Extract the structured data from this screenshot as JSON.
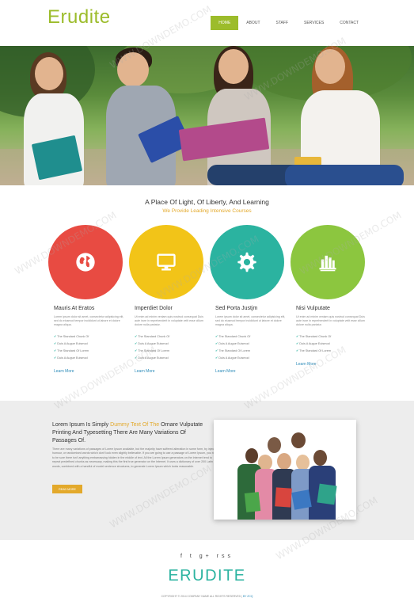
{
  "header": {
    "logo": "Erudite",
    "nav": [
      "HOME",
      "ABOUT",
      "STAFF",
      "SERVICES",
      "CONTACT"
    ],
    "active_nav": "HOME"
  },
  "intro": {
    "title": "A Place Of Light, Of Liberty, And Learning",
    "subtitle": "We Provide Leading Intensive Courses"
  },
  "features": [
    {
      "icon": "globe-icon",
      "color": "#e84b42",
      "title": "Mauris At Eratos",
      "text": "Lorem ipsum dolor sit amet, consectetur adipisicing elit, sed do eiusmod tempor incididunt ut labore et dolore magna aliqua.",
      "items": [
        "The Standard Chunk Of",
        "Duis A Augue Euismod",
        "The Standard Of Lorem",
        "Duis A Augue Euismod"
      ],
      "link": "Learn More"
    },
    {
      "icon": "monitor-icon",
      "color": "#f2c418",
      "title": "Imperdiet Dolor",
      "text": "Ut enim ad minim veniam quis nostrud consequat Duis aute irure in reprehenderit in voluptate velit esse cillum dolore nulla pariatur.",
      "items": [
        "The Standard Chunk Of",
        "Duis A Augue Euismod",
        "The Standard Of Lorem",
        "Duis A Augue Euismod"
      ],
      "link": "Learn More"
    },
    {
      "icon": "gear-icon",
      "color": "#2bb3a0",
      "title": "Sed Porta Justjm",
      "text": "Lorem ipsum dolor sit amet, consectetur adipisicing elit, sed do eiusmod tempor incididunt ut labore et dolore magna aliqua.",
      "items": [
        "The Standard Chunk Of",
        "Duis A Augue Euismod",
        "The Standard Of Lorem",
        "Duis A Augue Euismod"
      ],
      "link": "Learn More"
    },
    {
      "icon": "building-icon",
      "color": "#8cc63f",
      "title": "Nisi Vulputate",
      "text": "Ut enim ad minim veniam quis nostrud consequat Duis aute irure in reprehenderit in voluptate velit esse cillum dolore nulla pariatur.",
      "items": [
        "The Standard Chunk Of",
        "Duis A Augue Euismod",
        "The Standard Of Lorem"
      ],
      "link": "Learn More"
    }
  ],
  "about": {
    "heading_before": "Lorem Ipsum Is Simply ",
    "heading_highlight": "Dummy Text Of The",
    "heading_after": " Ornare Vulputate Printing And Typesetting There Are Many Variations Of Passages Of.",
    "text": "There are many variations of passages of Lorem Ipsum available, but the majority have suffered alteration in some form, by injected humour, or randomised words which don't look even slightly believable. If you are going to use a passage of Lorem Ipsum, you need to be sure there isn't anything embarrassing hidden in the middle of text. All the Lorem Ipsum generators on the Internet tend to repeat predefined chunks as necessary, making this the first true generator on the Internet. It uses a dictionary of over 200 Latin words, combined with a handful of model sentence structures, to generate Lorem Ipsum which looks reasonable.",
    "button": "READ MORE"
  },
  "footer": {
    "social": "f  t  g+  rss",
    "logo": "ERUDITE",
    "copyright_text": "COPYRIGHT © 2014 COMPANY NAME ALL RIGHTS RESERVED | ",
    "copyright_link": "BY ZCQ"
  },
  "watermark": "WWW.DOWNDEMO.COM"
}
